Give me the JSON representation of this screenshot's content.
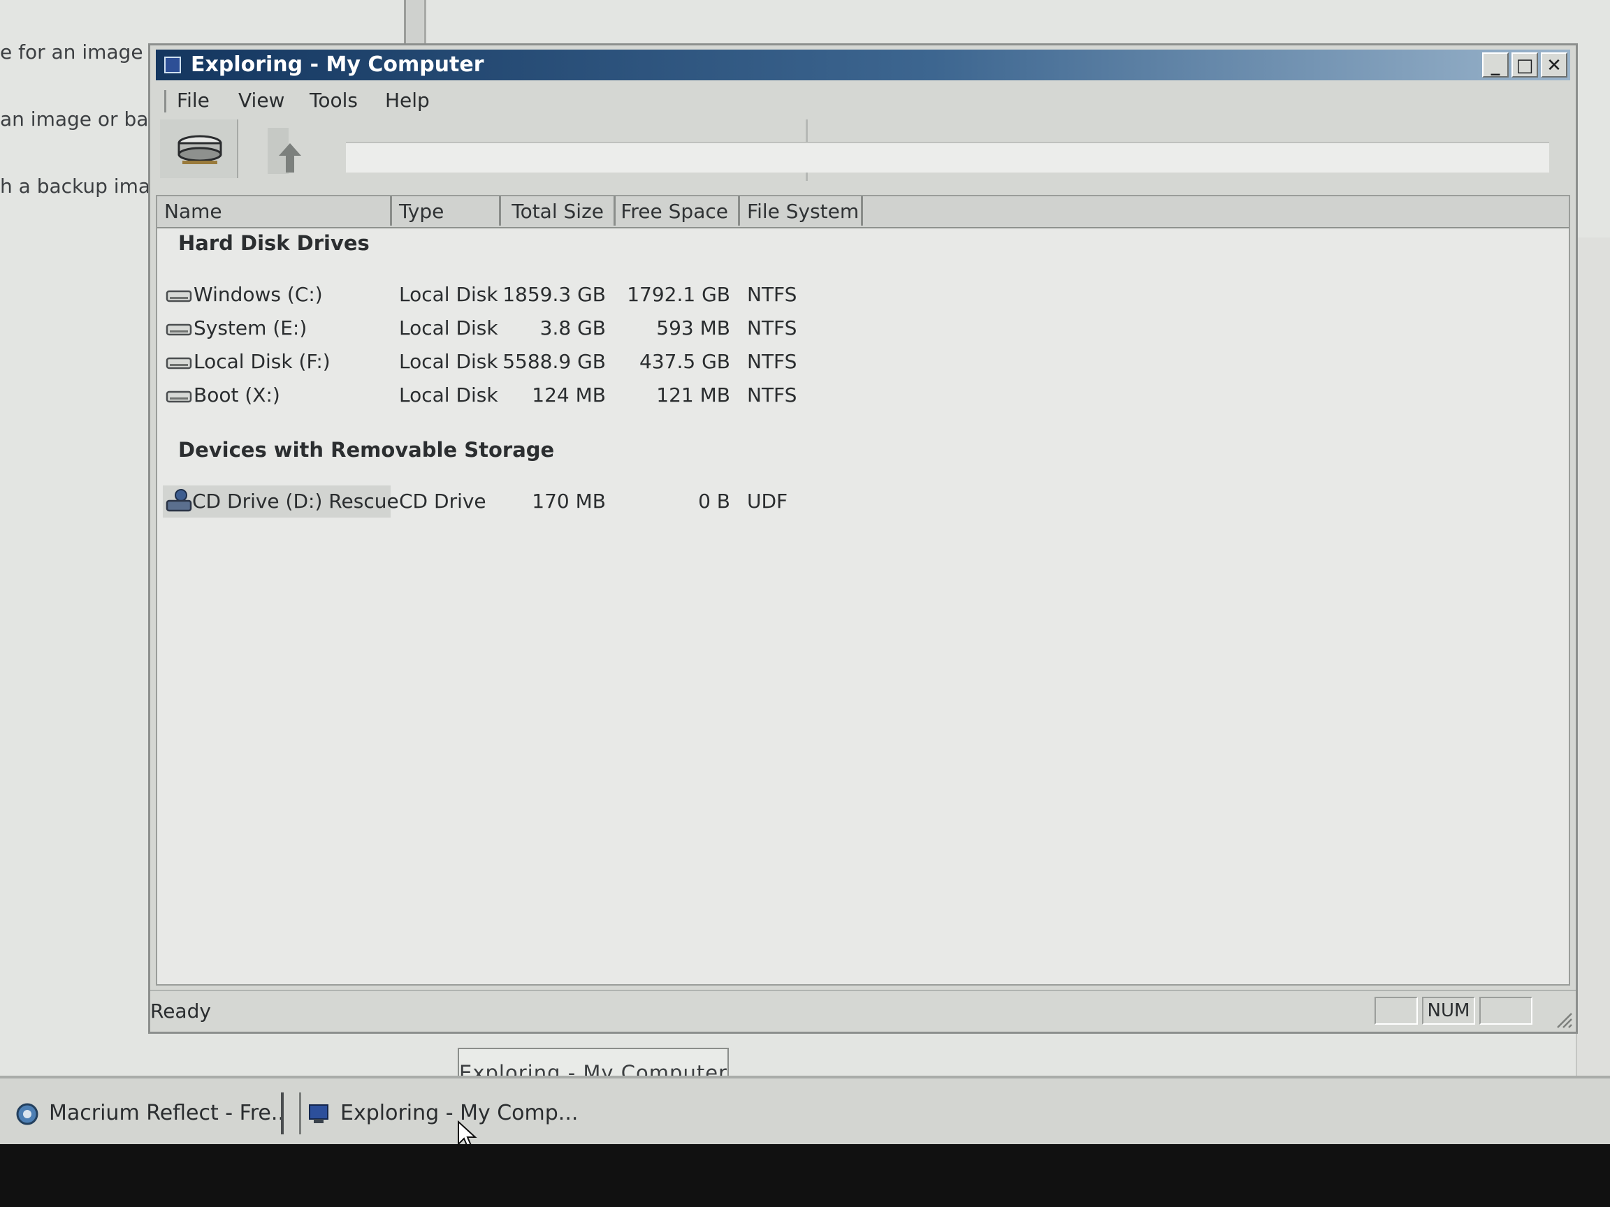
{
  "background_app": {
    "text_lines": [
      "e for an image or",
      "an image or back",
      "h a backup image"
    ]
  },
  "window": {
    "title": "Exploring - My Computer",
    "controls": {
      "minimize": "_",
      "maximize": "□",
      "close": "✕"
    },
    "menu": [
      "File",
      "View",
      "Tools",
      "Help"
    ],
    "toolbar": {
      "drive_icon": "drive-icon",
      "up_icon": "up-arrow-icon",
      "address_value": ""
    },
    "columns": [
      "Name",
      "Type",
      "Total Size",
      "Free Space",
      "File System"
    ],
    "groups": [
      {
        "title": "Hard Disk Drives",
        "rows": [
          {
            "name": "Windows (C:)",
            "type": "Local Disk",
            "total": "1859.3 GB",
            "free": "1792.1 GB",
            "fs": "NTFS",
            "icon": "hard-disk-icon"
          },
          {
            "name": "System (E:)",
            "type": "Local Disk",
            "total": "3.8 GB",
            "free": "593 MB",
            "fs": "NTFS",
            "icon": "hard-disk-icon"
          },
          {
            "name": "Local Disk (F:)",
            "type": "Local Disk",
            "total": "5588.9 GB",
            "free": "437.5 GB",
            "fs": "NTFS",
            "icon": "hard-disk-icon"
          },
          {
            "name": "Boot (X:)",
            "type": "Local Disk",
            "total": "124 MB",
            "free": "121 MB",
            "fs": "NTFS",
            "icon": "hard-disk-icon"
          }
        ]
      },
      {
        "title": "Devices with Removable Storage",
        "rows": [
          {
            "name": "CD Drive (D:) Rescue",
            "type": "CD Drive",
            "total": "170 MB",
            "free": "0 B",
            "fs": "UDF",
            "icon": "cd-drive-icon",
            "selected": true
          }
        ]
      }
    ],
    "status": {
      "text": "Ready",
      "panes": [
        "",
        "NUM",
        ""
      ]
    }
  },
  "tooltip": "Exploring - My Computer",
  "taskbar": [
    {
      "label": "Macrium Reflect - Fre...",
      "icon": "macrium-icon"
    },
    {
      "label": "Exploring - My Comp...",
      "icon": "explorer-icon"
    }
  ],
  "colors": {
    "titlebar_start": "#14365f",
    "titlebar_end": "#9ab4cb",
    "window_bg": "#d5d7d3",
    "list_bg": "#e8e9e7"
  }
}
